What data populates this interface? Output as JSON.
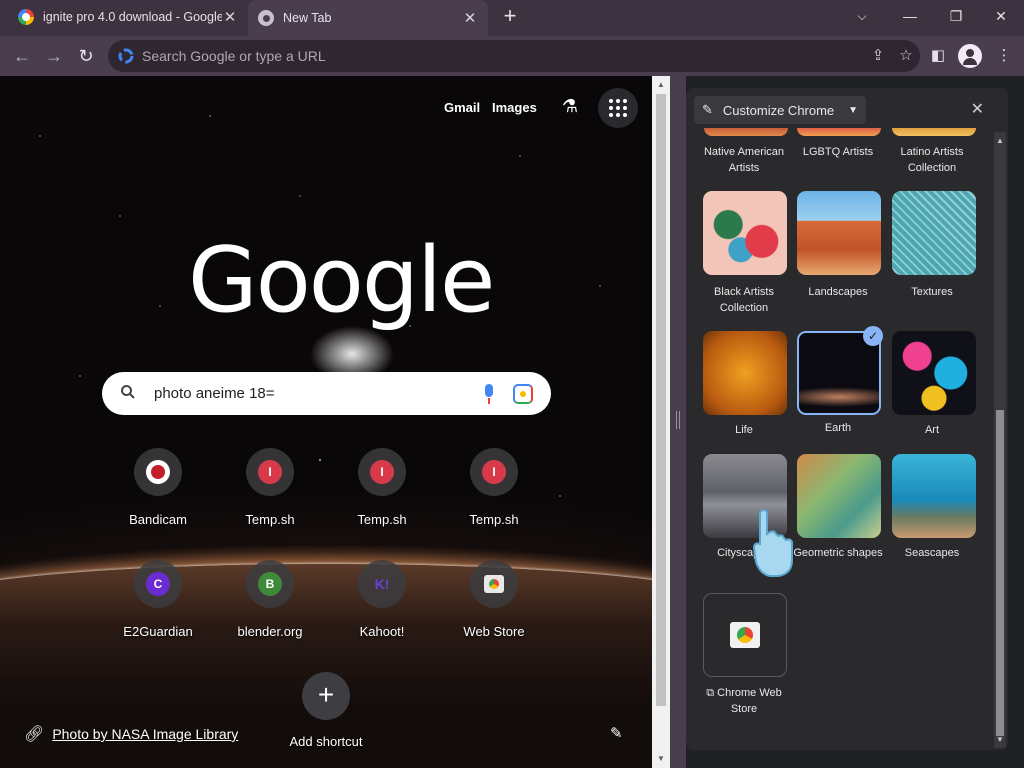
{
  "tabs": [
    {
      "title": "ignite pro 4.0 download - Google",
      "close": "✕"
    },
    {
      "title": "New Tab",
      "close": "✕"
    }
  ],
  "new_tab_glyph": "+",
  "window_controls": {
    "minimize": "⌵",
    "restore": "—",
    "maximize": "❐",
    "close": "✕"
  },
  "omnibox": {
    "placeholder": "Search Google or type a URL"
  },
  "ntp": {
    "gmail": "Gmail",
    "images": "Images",
    "logo": "Google",
    "search_query": "photo aneime 18=",
    "shortcuts": [
      {
        "label": "Bandicam",
        "icon": "●",
        "icon_color": "#c41e2a"
      },
      {
        "label": "Temp.sh",
        "icon": "I",
        "icon_color": "#d93a4a"
      },
      {
        "label": "Temp.sh",
        "icon": "I",
        "icon_color": "#d93a4a"
      },
      {
        "label": "Temp.sh",
        "icon": "I",
        "icon_color": "#d93a4a"
      },
      {
        "label": "E2Guardian",
        "icon": "C",
        "icon_color": "#6a2bd0"
      },
      {
        "label": "blender.org",
        "icon": "B",
        "icon_color": "#3f8a3a"
      },
      {
        "label": "Kahoot!",
        "icon": "K!",
        "icon_color": "#46178f"
      },
      {
        "label": "Web Store",
        "icon": "◉",
        "icon_color": "#e8e8e8"
      }
    ],
    "add_shortcut": "Add shortcut",
    "photo_credit": "Photo by NASA Image Library"
  },
  "side_panel": {
    "title": "Customize Chrome",
    "close": "✕",
    "categories": [
      {
        "label": "Native American Artists",
        "selected": false
      },
      {
        "label": "LGBTQ Artists",
        "selected": false
      },
      {
        "label": "Latino Artists Collection",
        "selected": false
      },
      {
        "label": "Black Artists Collection",
        "selected": false
      },
      {
        "label": "Landscapes",
        "selected": false
      },
      {
        "label": "Textures",
        "selected": false
      },
      {
        "label": "Life",
        "selected": false
      },
      {
        "label": "Earth",
        "selected": true
      },
      {
        "label": "Art",
        "selected": false
      },
      {
        "label": "Cityscapes",
        "selected": false
      },
      {
        "label": "Geometric shapes",
        "selected": false
      },
      {
        "label": "Seascapes",
        "selected": false
      }
    ],
    "web_store_label": "Chrome Web Store"
  },
  "colors": {
    "tabstrip": "#3c3240",
    "toolbar": "#4a3d4e",
    "panel": "#2a2a2d",
    "accent": "#8ab4f8"
  }
}
